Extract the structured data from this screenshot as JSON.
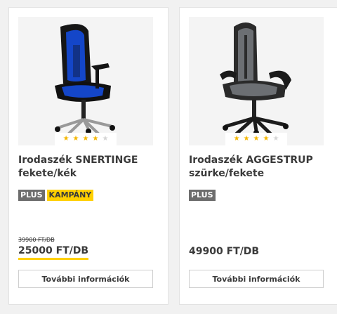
{
  "products": [
    {
      "image_alt": "office-chair-blue-black",
      "rating_stars": [
        true,
        true,
        true,
        true,
        false
      ],
      "title": "Irodaszék SNERTINGE fekete/kék",
      "badges": [
        "PLUS",
        "KAMPÁNY"
      ],
      "old_price": "39900 FT/DB",
      "price": "25000 FT/DB",
      "button_label": "További információk"
    },
    {
      "image_alt": "office-chair-grey-black",
      "rating_stars": [
        true,
        true,
        true,
        true,
        false
      ],
      "title": "Irodaszék AGGESTRUP szürke/fekete",
      "badges": [
        "PLUS"
      ],
      "old_price": "",
      "price": "49900 FT/DB",
      "button_label": "További információk"
    }
  ],
  "colors": {
    "accent_yellow": "#ffd000",
    "badge_grey": "#6d6d6d",
    "star": "#f3b600"
  }
}
